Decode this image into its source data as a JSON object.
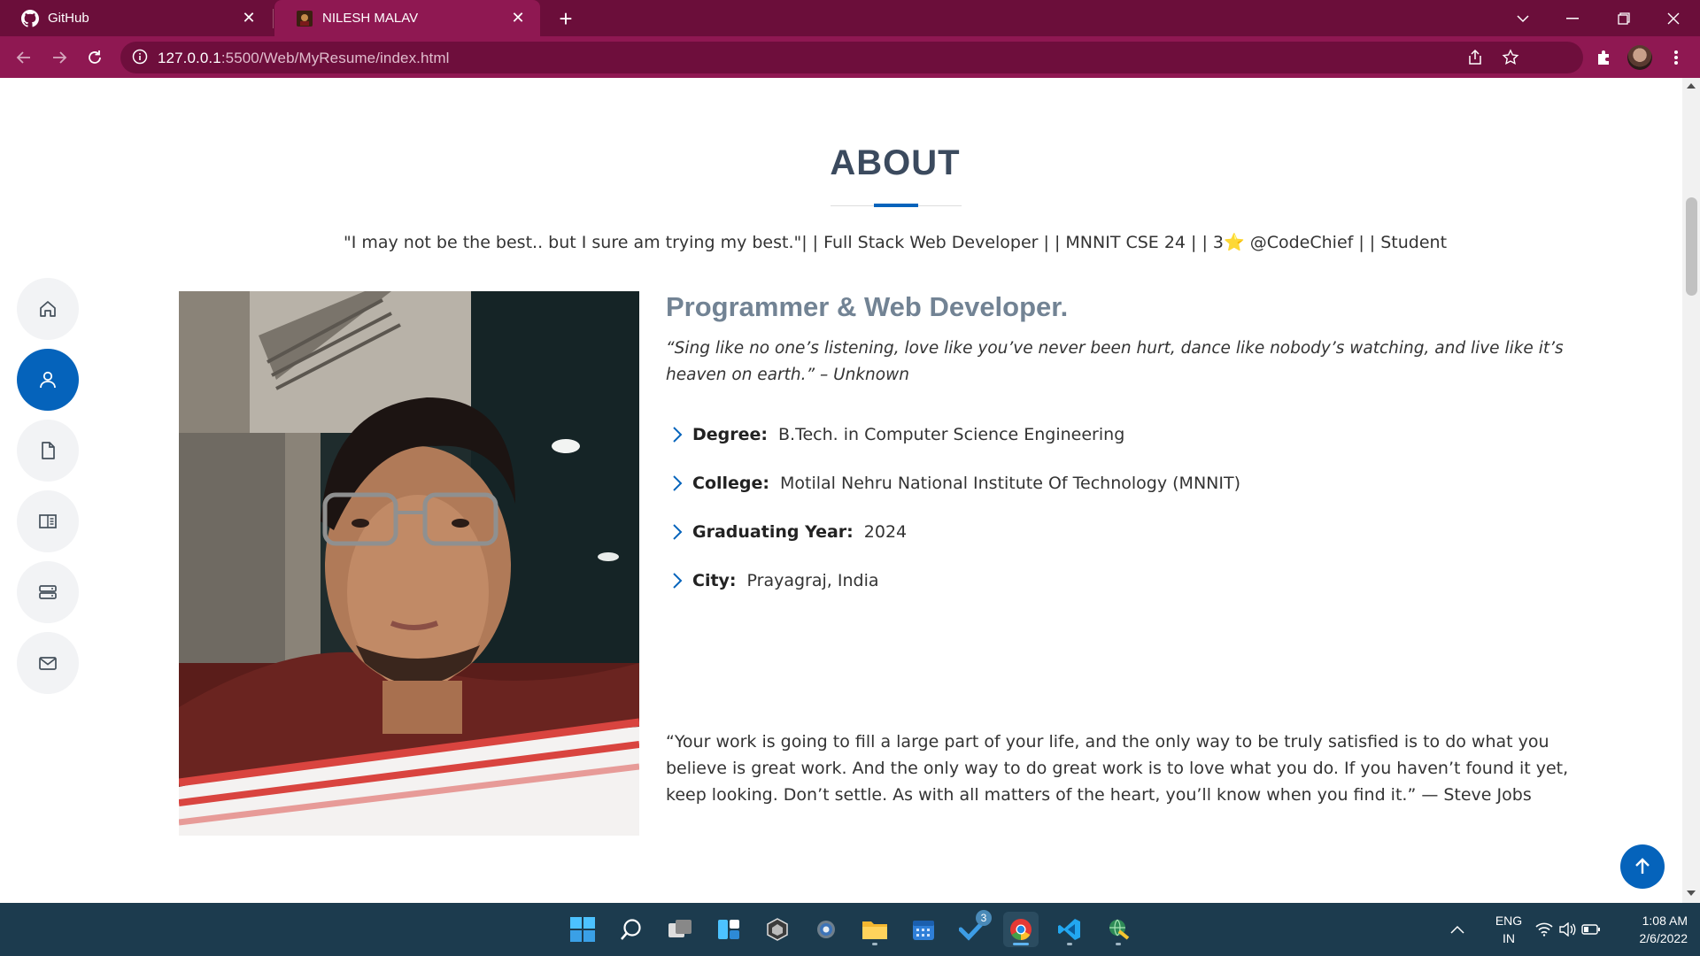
{
  "browser": {
    "tabs": [
      {
        "title": "GitHub",
        "icon": "github-icon",
        "active": false
      },
      {
        "title": "NILESH MALAV",
        "icon": "site-favicon",
        "active": true
      }
    ],
    "url_host": "127.0.0.1",
    "url_rest": ":5500/Web/MyResume/index.html",
    "theme_color": "#8f1852"
  },
  "sidenav": {
    "items": [
      {
        "name": "home",
        "icon": "home-icon",
        "active": false
      },
      {
        "name": "about",
        "icon": "person-icon",
        "active": true
      },
      {
        "name": "resume",
        "icon": "file-icon",
        "active": false
      },
      {
        "name": "portfolio",
        "icon": "book-icon",
        "active": false
      },
      {
        "name": "services",
        "icon": "server-icon",
        "active": false
      },
      {
        "name": "contact",
        "icon": "envelope-icon",
        "active": false
      }
    ],
    "accent": "#0563bb"
  },
  "about": {
    "section_title": "ABOUT",
    "tagline": "\"I may not be the best.. but I sure am trying my best.\"| | Full Stack Web Developer | | MNNIT CSE 24 | | 3⭐ @CodeChief | | Student",
    "heading": "Programmer & Web Developer.",
    "quote": "“Sing like no one’s listening, love like you’ve never been hurt, dance like nobody’s watching, and live like it’s heaven on earth.” – Unknown",
    "facts": [
      {
        "label": "Degree:",
        "value": "B.Tech. in Computer Science Engineering"
      },
      {
        "label": "College:",
        "value": "Motilal Nehru National Institute Of Technology (MNNIT)"
      },
      {
        "label": "Graduating Year:",
        "value": "2024"
      },
      {
        "label": "City:",
        "value": "Prayagraj, India"
      }
    ],
    "closing_quote": "“Your work is going to fill a large part of your life, and the only way to be truly satisfied is to do what you believe is great work. And the only way to do great work is to love what you do. If you haven’t found it yet, keep looking. Don’t settle. As with all matters of the heart, you’ll know when you find it.” — Steve Jobs"
  },
  "taskbar": {
    "apps": [
      {
        "name": "start",
        "icon": "windows-icon"
      },
      {
        "name": "search",
        "icon": "search-icon"
      },
      {
        "name": "task-view",
        "icon": "task-view-icon"
      },
      {
        "name": "widgets",
        "icon": "widgets-icon"
      },
      {
        "name": "unity",
        "icon": "unity-icon"
      },
      {
        "name": "settings",
        "icon": "gear-icon"
      },
      {
        "name": "file-explorer",
        "icon": "folder-icon"
      },
      {
        "name": "calendar",
        "icon": "calendar-icon"
      },
      {
        "name": "todo",
        "icon": "checkmark-icon",
        "badge": "3"
      },
      {
        "name": "chrome",
        "icon": "chrome-icon"
      },
      {
        "name": "vscode",
        "icon": "vscode-icon"
      },
      {
        "name": "network-app",
        "icon": "globe-icon"
      }
    ],
    "language": "ENG",
    "region": "IN",
    "time": "1:08 AM",
    "date": "2/6/2022"
  }
}
